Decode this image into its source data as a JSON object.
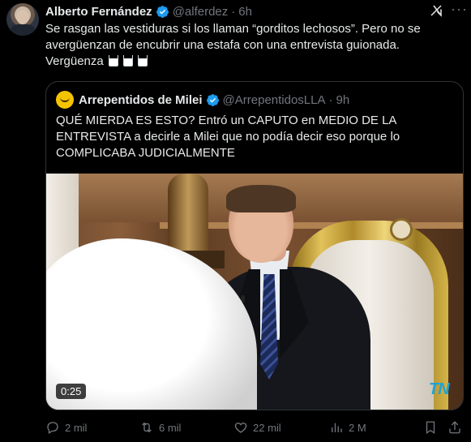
{
  "author": {
    "name": "Alberto Fernández",
    "handle": "@alferdez",
    "time": "6h"
  },
  "tweet_text": "Se rasgan las vestiduras si los llaman “gorditos lechosos”. Pero no se avergüenzan de encubrir una estafa con una entrevista guionada. Vergüenza",
  "quoted": {
    "name": "Arrepentidos de Milei",
    "handle": "@ArrepentidosLLA",
    "time": "9h",
    "text": "QUÉ MIERDA ES ESTO? Entró un CAPUTO en MEDIO DE LA ENTREVISTA a decirle a Milei que no podía decir eso porque lo COMPLICABA JUDICIALMENTE",
    "video_duration": "0:25",
    "channel_logo": "TN"
  },
  "stats": {
    "replies": "2 mil",
    "reposts": "6 mil",
    "likes": "22 mil",
    "views": "2 M"
  },
  "colors": {
    "background": "#000000",
    "text": "#e7e9ea",
    "muted": "#71767b",
    "verified": "#1d9bf0",
    "border": "#2f3336"
  }
}
